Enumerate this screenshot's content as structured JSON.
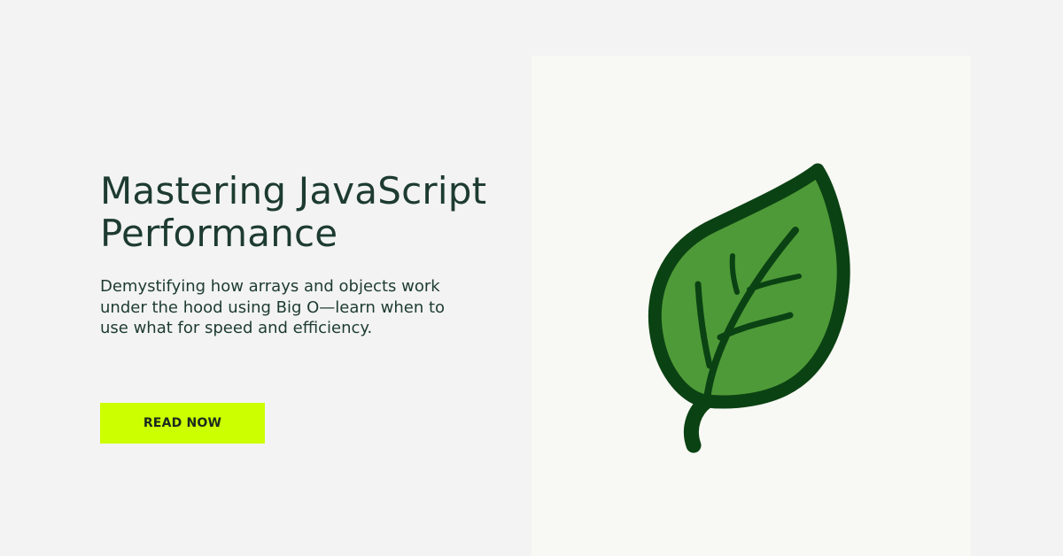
{
  "hero": {
    "title_line1": "Mastering JavaScript",
    "title_line2": "Performance",
    "description": "Demystifying how arrays and objects work under the hood using Big O—learn when to use what for speed and efficiency.",
    "cta_label": "READ NOW"
  },
  "illustration": {
    "icon": "leaf-icon"
  },
  "colors": {
    "background": "#f3f3f3",
    "panel": "#f8f8f4",
    "text": "#1d3b30",
    "cta": "#ccff00",
    "leaf_fill": "#4e9a38",
    "leaf_outline": "#0b4213"
  }
}
